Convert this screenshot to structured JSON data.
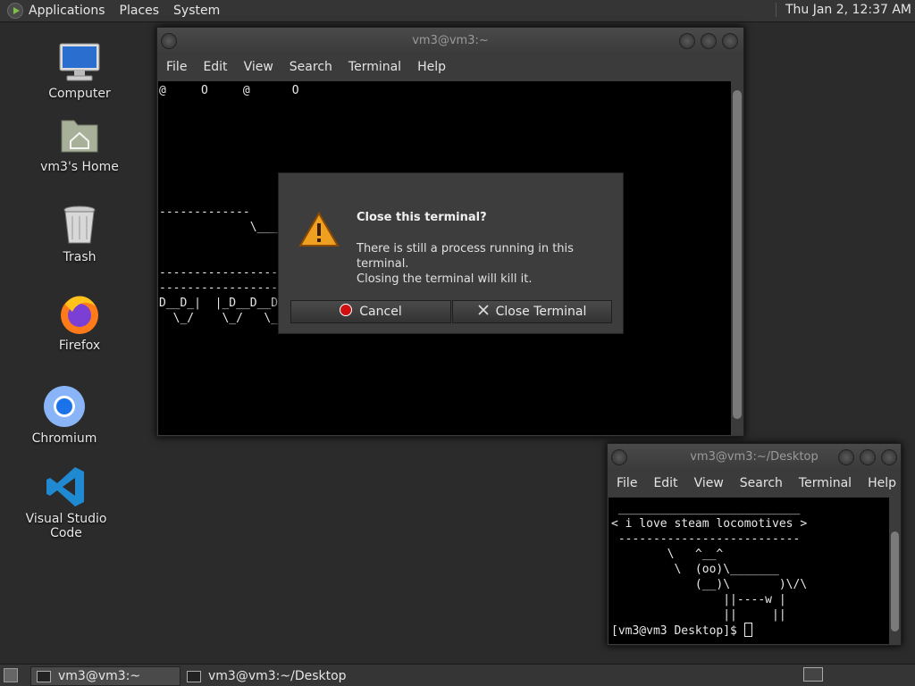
{
  "top_panel": {
    "menus": [
      "Applications",
      "Places",
      "System"
    ],
    "clock": "Thu Jan  2, 12:37 AM"
  },
  "desktop_icons": [
    {
      "label": "Computer",
      "icon": "computer-icon"
    },
    {
      "label": "vm3's Home",
      "icon": "home-folder-icon"
    },
    {
      "label": "Trash",
      "icon": "trash-icon"
    },
    {
      "label": "Firefox",
      "icon": "firefox-icon"
    },
    {
      "label": "Chromium",
      "icon": "chromium-icon"
    },
    {
      "label": "Visual Studio Code",
      "icon": "vscode-icon"
    }
  ],
  "main_terminal": {
    "title": "vm3@vm3:~",
    "menu": [
      "File",
      "Edit",
      "View",
      "Search",
      "Terminal",
      "Help"
    ],
    "lines": [
      "@     O     @      O",
      "",
      "",
      "",
      "",
      "",
      "",
      "",
      "-------------",
      "             \\___",
      "",
      "",
      "-----------------",
      "-----------------",
      "D__D_|  |_D__D__D_",
      "  \\_/    \\_/   \\_/"
    ]
  },
  "dialog": {
    "title": "Close this terminal?",
    "message_line1": "There is still a process running in this terminal.",
    "message_line2": "Closing the terminal will kill it.",
    "cancel_label": "Cancel",
    "close_label": "Close Terminal"
  },
  "desktop_terminal": {
    "title": "vm3@vm3:~/Desktop",
    "menu": [
      "File",
      "Edit",
      "View",
      "Search",
      "Terminal",
      "Help"
    ],
    "lines": [
      " __________________________",
      "< i love steam locomotives >",
      " --------------------------",
      "        \\   ^__^",
      "         \\  (oo)\\_______",
      "            (__)\\       )\\/\\",
      "                ||----w |",
      "                ||     ||",
      "[vm3@vm3 Desktop]$ "
    ]
  },
  "taskbar": {
    "items": [
      {
        "label": "vm3@vm3:~",
        "active": true
      },
      {
        "label": "vm3@vm3:~/Desktop",
        "active": false
      }
    ]
  },
  "colors": {
    "desktop_bg": "#2b2b2b",
    "panel_bg": "#353535",
    "terminal_bg": "#000000",
    "warning": "#f0a020",
    "cancel_icon": "#d01010"
  }
}
